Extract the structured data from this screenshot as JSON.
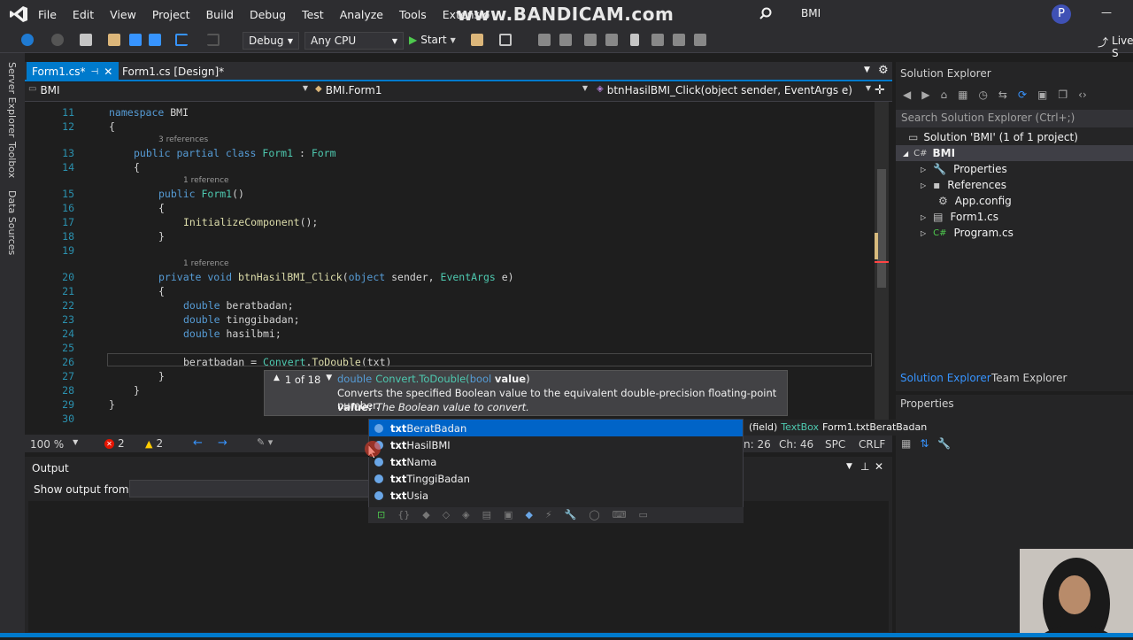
{
  "title": {
    "app_label": "BMI",
    "watermark": "www.BANDICAM.com",
    "user_initial": "P",
    "minimize": "—",
    "live_share": "Live S"
  },
  "menu": [
    "File",
    "Edit",
    "View",
    "Project",
    "Build",
    "Debug",
    "Test",
    "Analyze",
    "Tools",
    "Extensio"
  ],
  "toolbar": {
    "config": "Debug",
    "platform": "Any CPU",
    "start": "Start"
  },
  "side_tabs": [
    "Server Explorer",
    "Toolbox",
    "Data Sources"
  ],
  "tabs": [
    {
      "label": "Form1.cs*",
      "active": true
    },
    {
      "label": "Form1.cs [Design]*",
      "active": false
    }
  ],
  "nav": {
    "project": "BMI",
    "class": "BMI.Form1",
    "member": "btnHasilBMI_Click(object sender, EventArgs e)"
  },
  "code_lines": [
    {
      "n": "11",
      "tokens": [
        {
          "t": "namespace",
          "c": "kw"
        },
        {
          "t": " BMI",
          "c": "cl"
        }
      ],
      "indent": 0
    },
    {
      "n": "12",
      "tokens": [
        {
          "t": "{",
          "c": "cl"
        }
      ],
      "indent": 0
    },
    {
      "n": "13",
      "tokens": [
        {
          "t": "public partial class",
          "c": "kw"
        },
        {
          "t": " Form1",
          "c": "ty"
        },
        {
          "t": " : ",
          "c": "cl"
        },
        {
          "t": "Form",
          "c": "ty"
        }
      ],
      "indent": 4,
      "lens": "3 references"
    },
    {
      "n": "14",
      "tokens": [
        {
          "t": "{",
          "c": "cl"
        }
      ],
      "indent": 4
    },
    {
      "n": "15",
      "tokens": [
        {
          "t": "public",
          "c": "kw"
        },
        {
          "t": " Form1",
          "c": "ty"
        },
        {
          "t": "()",
          "c": "cl"
        }
      ],
      "indent": 8,
      "lens": "1 reference"
    },
    {
      "n": "16",
      "tokens": [
        {
          "t": "{",
          "c": "cl"
        }
      ],
      "indent": 8
    },
    {
      "n": "17",
      "tokens": [
        {
          "t": "InitializeComponent",
          "c": "fn"
        },
        {
          "t": "();",
          "c": "cl"
        }
      ],
      "indent": 12
    },
    {
      "n": "18",
      "tokens": [
        {
          "t": "}",
          "c": "cl"
        }
      ],
      "indent": 8
    },
    {
      "n": "19",
      "tokens": [],
      "indent": 0
    },
    {
      "n": "20",
      "tokens": [
        {
          "t": "private void",
          "c": "kw"
        },
        {
          "t": " btnHasilBMI_Click",
          "c": "fn"
        },
        {
          "t": "(",
          "c": "cl"
        },
        {
          "t": "object",
          "c": "kw"
        },
        {
          "t": " sender, ",
          "c": "cl"
        },
        {
          "t": "EventArgs",
          "c": "ty"
        },
        {
          "t": " e)",
          "c": "cl"
        }
      ],
      "indent": 8,
      "lens": "1 reference"
    },
    {
      "n": "21",
      "tokens": [
        {
          "t": "{",
          "c": "cl"
        }
      ],
      "indent": 8
    },
    {
      "n": "22",
      "tokens": [
        {
          "t": "double",
          "c": "kw"
        },
        {
          "t": " beratbadan;",
          "c": "cl"
        }
      ],
      "indent": 12
    },
    {
      "n": "23",
      "tokens": [
        {
          "t": "double",
          "c": "kw"
        },
        {
          "t": " tinggibadan;",
          "c": "cl"
        }
      ],
      "indent": 12
    },
    {
      "n": "24",
      "tokens": [
        {
          "t": "double",
          "c": "kw"
        },
        {
          "t": " hasilbmi;",
          "c": "cl"
        }
      ],
      "indent": 12
    },
    {
      "n": "25",
      "tokens": [],
      "indent": 0
    },
    {
      "n": "26",
      "tokens": [
        {
          "t": "beratbadan = ",
          "c": "cl"
        },
        {
          "t": "Convert",
          "c": "ty"
        },
        {
          "t": ".",
          "c": "cl"
        },
        {
          "t": "ToDouble",
          "c": "fn"
        },
        {
          "t": "(txt)",
          "c": "cl"
        }
      ],
      "indent": 12
    },
    {
      "n": "27",
      "tokens": [
        {
          "t": "}",
          "c": "cl"
        }
      ],
      "indent": 8
    },
    {
      "n": "28",
      "tokens": [
        {
          "t": "}",
          "c": "cl"
        }
      ],
      "indent": 4
    },
    {
      "n": "29",
      "tokens": [
        {
          "t": "}",
          "c": "cl"
        }
      ],
      "indent": 0
    },
    {
      "n": "30",
      "tokens": [],
      "indent": 0
    }
  ],
  "tooltip": {
    "counter": "1 of 18",
    "sig_type": "double",
    "sig_method": "Convert.ToDouble(",
    "sig_param_type": "bool",
    "sig_param": "value",
    "sig_close": ")",
    "desc": "Converts the specified Boolean value to the equivalent double-precision floating-point number.",
    "param_label": "value:",
    "param_desc": "The Boolean value to convert."
  },
  "completion": [
    {
      "prefix": "txt",
      "rest": "BeratBadan",
      "selected": true
    },
    {
      "prefix": "txt",
      "rest": "HasilBMI",
      "selected": false
    },
    {
      "prefix": "txt",
      "rest": "Nama",
      "selected": false
    },
    {
      "prefix": "txt",
      "rest": "TinggiBadan",
      "selected": false
    },
    {
      "prefix": "txt",
      "rest": "Usia",
      "selected": false
    }
  ],
  "completion_hint": {
    "kind": "(field)",
    "type": "TextBox",
    "member": "Form1.txtBeratBadan"
  },
  "status": {
    "zoom": "100 %",
    "errors": "2",
    "warnings": "2",
    "ln": "n: 26",
    "ch": "Ch: 46",
    "spc": "SPC",
    "crlf": "CRLF"
  },
  "output": {
    "title": "Output",
    "show_from": "Show output from:"
  },
  "solution_explorer": {
    "title": "Solution Explorer",
    "search_placeholder": "Search Solution Explorer (Ctrl+;)",
    "solution": "Solution 'BMI' (1 of 1 project)",
    "project": "BMI",
    "items": [
      "Properties",
      "References",
      "App.config",
      "Form1.cs",
      "Program.cs"
    ],
    "tab_active": "Solution Explorer",
    "tab_other": "Team Explorer"
  },
  "properties": {
    "title": "Properties"
  }
}
